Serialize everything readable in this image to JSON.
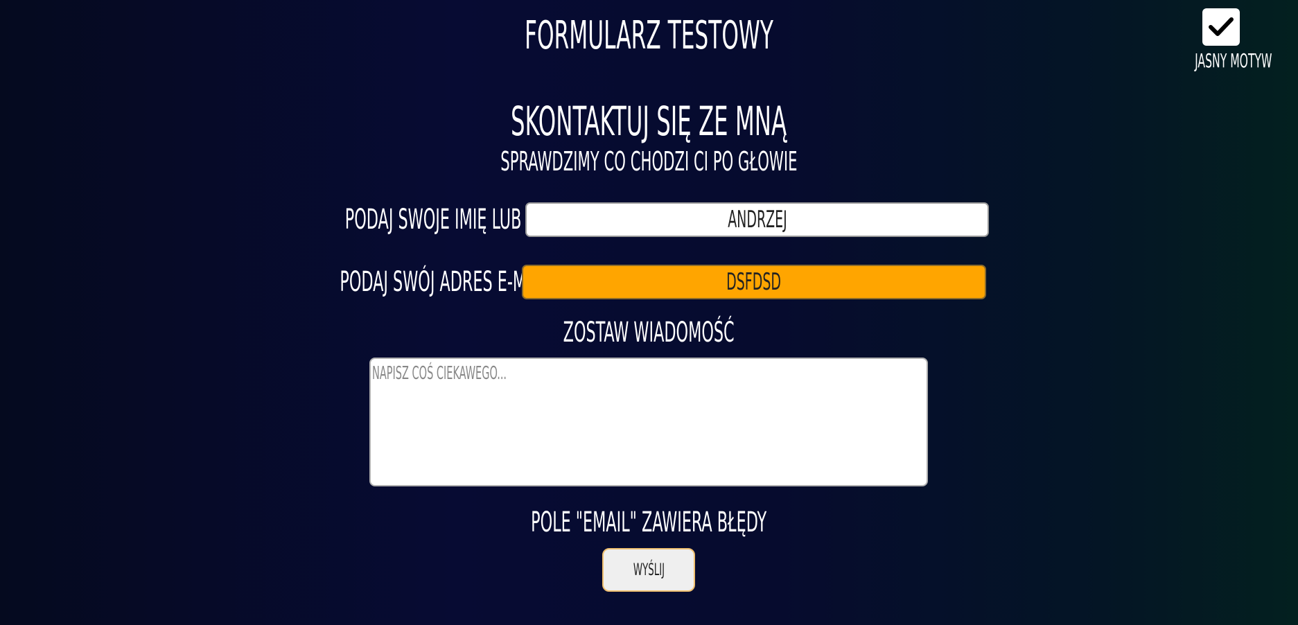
{
  "header": {
    "title": "Formularz testowy"
  },
  "theme_toggle": {
    "label": "Jasny motyw",
    "checked": true,
    "icon": "checkmark-icon"
  },
  "contact": {
    "title": "Skontaktuj się ze mną",
    "subtitle": "Sprawdzimy co chodzi Ci po głowie"
  },
  "form": {
    "name_label": "Podaj swoje imię lub nick:",
    "name_value": "Andrzej",
    "email_label": "Podaj swój adres e-mail:",
    "email_value": "dsfdsd",
    "message_label": "Zostaw wiadomość",
    "message_placeholder": "Napisz coś ciekawego...",
    "error_message": "Pole \"email\" zawiera błędy",
    "submit_label": "Wyślij"
  },
  "colors": {
    "email_invalid_bg": "#ffa500",
    "field_bg": "#ffffff",
    "button_border": "#f0c070"
  }
}
